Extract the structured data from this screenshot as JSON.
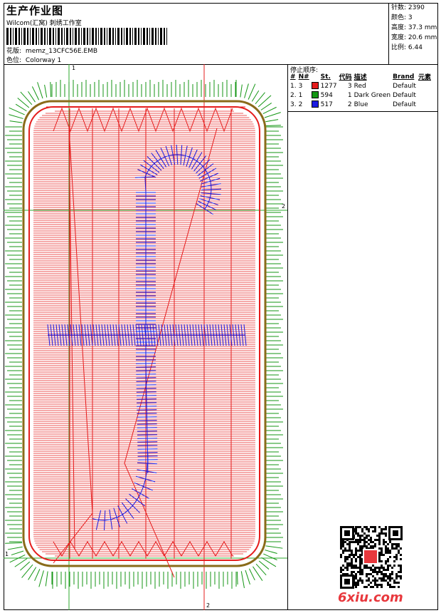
{
  "header": {
    "title": "生产作业图",
    "studio": "Wilcom(汇窝) 刺绣工作室",
    "design_label": "花版:",
    "design_value": "memz_13CFC56E.EMB",
    "colorway_label": "色位:",
    "colorway_value": "Colorway 1"
  },
  "stats": {
    "stitches_label": "针数:",
    "stitches_value": "2390",
    "colors_label": "颜色:",
    "colors_value": "3",
    "height_label": "高度:",
    "height_value": "37.3 mm",
    "width_label": "宽度:",
    "width_value": "20.6 mm",
    "scale_label": "比例:",
    "scale_value": "6.44"
  },
  "sequence": {
    "title": "停止顺序:",
    "headers": {
      "num": "#",
      "no": "N#",
      "st": "St.",
      "code": "代码",
      "desc": "描述",
      "brand": "Brand",
      "element": "元素"
    },
    "rows": [
      {
        "num": "1.",
        "no": "3",
        "color": "#e51c1c",
        "st": "1277",
        "code": "3",
        "desc": "Red",
        "brand": "Default"
      },
      {
        "num": "2.",
        "no": "1",
        "color": "#149614",
        "st": "594",
        "code": "1",
        "desc": "Dark Green",
        "brand": "Default"
      },
      {
        "num": "3.",
        "no": "2",
        "color": "#1a1ae0",
        "st": "517",
        "code": "2",
        "desc": "Blue",
        "brand": "Default"
      }
    ]
  },
  "design": {
    "mark_top": "1",
    "mark_left": "1",
    "mark_bottom": "2",
    "mark_right": "2",
    "colors": {
      "red": "#e51c1c",
      "green": "#149614",
      "blue": "#1a1ae0",
      "guide": "#2ea82e"
    }
  },
  "watermark": {
    "text": "6xiu.com"
  }
}
